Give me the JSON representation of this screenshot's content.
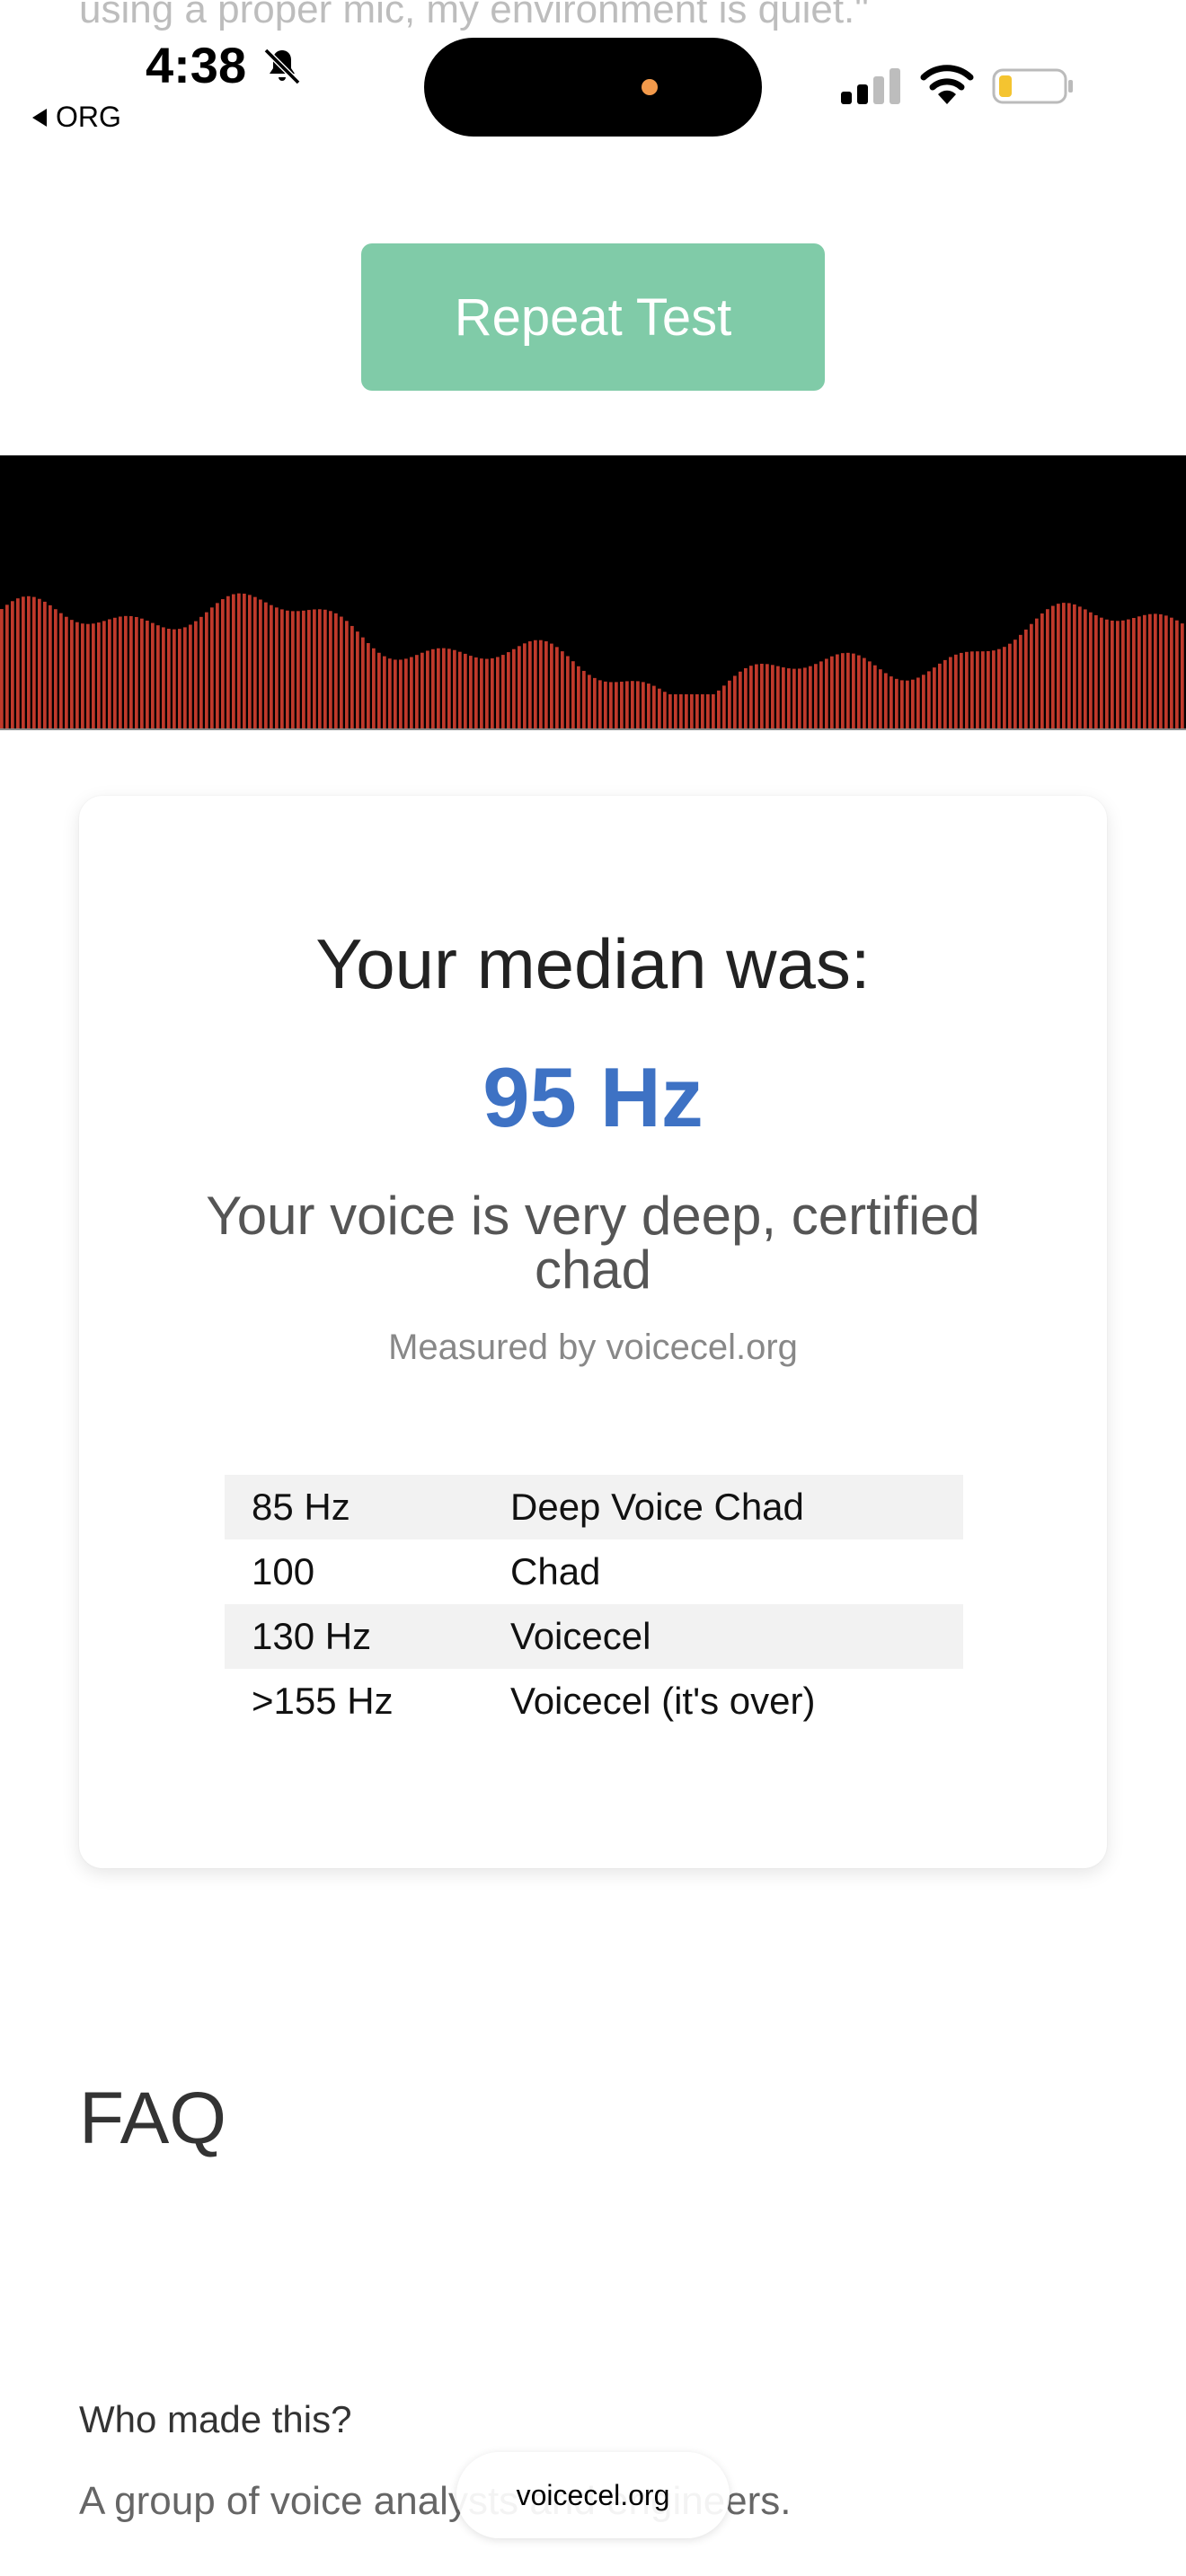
{
  "page": {
    "faded_intro_line": "using a proper mic, my environment is quiet.\""
  },
  "status_bar": {
    "time": "4:38",
    "back_label": "ORG"
  },
  "actions": {
    "repeat_label": "Repeat Test"
  },
  "result": {
    "median_label": "Your median was:",
    "median_value": "95 Hz",
    "verdict": "Your voice is very deep, certified chad",
    "measured_by": "Measured by voicecel.org",
    "scale": [
      {
        "range": "85 Hz",
        "label": "Deep Voice Chad"
      },
      {
        "range": "100",
        "label": "Chad"
      },
      {
        "range": "130 Hz",
        "label": "Voicecel"
      },
      {
        "range": ">155 Hz",
        "label": "Voicecel (it's over)"
      }
    ]
  },
  "faq": {
    "title": "FAQ",
    "items": [
      {
        "question": "Who made this?",
        "answer": "A group of voice analysts and engineers."
      }
    ]
  },
  "browser": {
    "url": "voicecel.org"
  },
  "colors": {
    "accent_button": "#80cba8",
    "median_value": "#3e72c4",
    "visualizer_bars": "#c0392b"
  },
  "icons": [
    "bell-slash-icon",
    "back-arrow-icon",
    "cellular-signal-icon",
    "wifi-icon",
    "battery-low-icon"
  ]
}
